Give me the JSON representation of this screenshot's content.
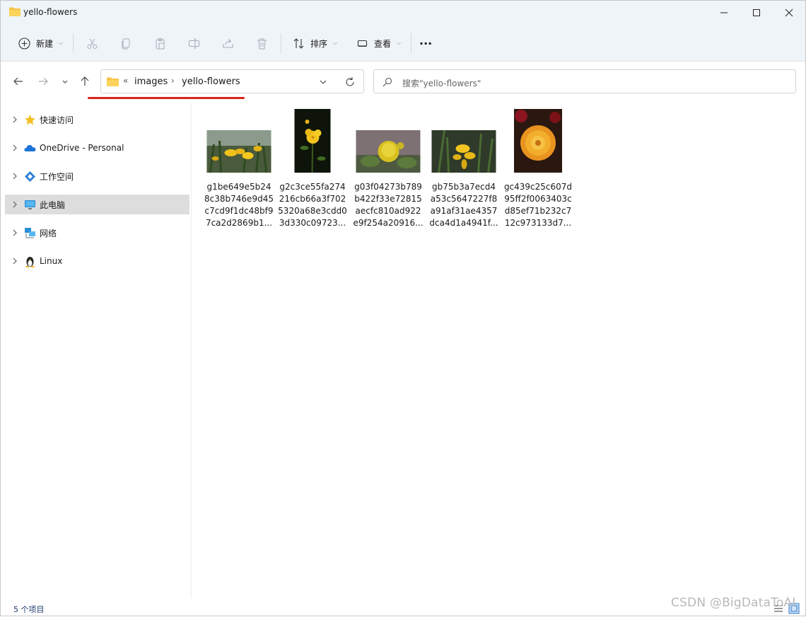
{
  "window": {
    "title": "yello-flowers"
  },
  "ribbon": {
    "new_label": "新建",
    "sort_label": "排序",
    "view_label": "查看",
    "more_label": "···"
  },
  "address": {
    "overflow": "«",
    "crumbs": [
      "images",
      "yello-flowers"
    ]
  },
  "search": {
    "placeholder": "搜索\"yello-flowers\""
  },
  "sidebar": {
    "items": [
      {
        "label": "快速访问",
        "icon": "star-icon"
      },
      {
        "label": "OneDrive - Personal",
        "icon": "onedrive-cloud-icon"
      },
      {
        "label": "工作空间",
        "icon": "workspace-diamond-icon"
      },
      {
        "label": "此电脑",
        "icon": "computer-monitor-icon",
        "selected": true
      },
      {
        "label": "网络",
        "icon": "network-icon"
      },
      {
        "label": "Linux",
        "icon": "linux-penguin-icon"
      }
    ]
  },
  "files": [
    {
      "name": "g1be649e5b24\n8c38b746e9d45\nc7cd9f1dc48bf9\n7ca2d2869b1...",
      "orientation": "landscape"
    },
    {
      "name": "g2c3ce55fa274\n216cb66a3f702\n5320a68e3cdd0\n3d330c09723...",
      "orientation": "portrait"
    },
    {
      "name": "g03f04273b789\nb422f33e72815\naecfc810ad922\ne9f254a20916...",
      "orientation": "landscape"
    },
    {
      "name": "gb75b3a7ecd4\na53c5647227f8\na91af31ae4357\ndca4d1a4941f...",
      "orientation": "landscape"
    },
    {
      "name": "gc439c25c607d\n95ff2f0063403c\nd85ef71b232c7\n12c973133d7...",
      "orientation": "portrait"
    }
  ],
  "status": {
    "item_count": "5 个项目"
  },
  "watermark": "CSDN @BigDataToAI",
  "colors": {
    "titlebar_bg": "#eef4f7",
    "selection": "#dddddd",
    "folder": "#f6c344",
    "annotation_red": "#d9261c"
  }
}
